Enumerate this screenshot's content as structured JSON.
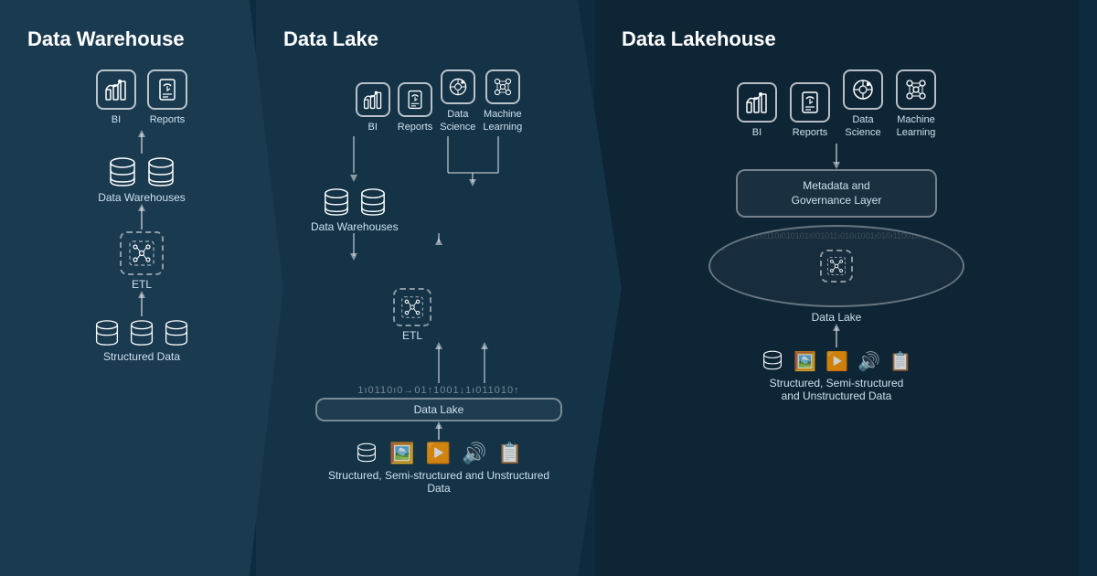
{
  "warehouse": {
    "title": "Data Warehouse",
    "icons": [
      {
        "label": "BI",
        "icon": "📊"
      },
      {
        "label": "Reports",
        "icon": "📄"
      }
    ],
    "dataWarehouses": "Data Warehouses",
    "etl": "ETL",
    "structuredData": "Structured Data"
  },
  "lake": {
    "title": "Data Lake",
    "icons": [
      {
        "label": "BI",
        "icon": "📊"
      },
      {
        "label": "Reports",
        "icon": "📄"
      },
      {
        "label": "Data\nScience",
        "icon": "🔍"
      },
      {
        "label": "Machine\nLearning",
        "icon": "🤖"
      }
    ],
    "dataWarehouses": "Data Warehouses",
    "etl": "ETL",
    "dataLake": "Data Lake",
    "structuredData": "Structured, Semi-structured and Unstructured Data"
  },
  "lakehouse": {
    "title": "Data Lakehouse",
    "icons": [
      {
        "label": "BI",
        "icon": "📊"
      },
      {
        "label": "Reports",
        "icon": "📄"
      },
      {
        "label": "Data\nScience",
        "icon": "🔍"
      },
      {
        "label": "Machine\nLearning",
        "icon": "🤖"
      }
    ],
    "metadataLayer": "Metadata and\nGovernance Layer",
    "dataLake": "Data Lake",
    "structuredData": "Structured, Semi-structured\nand Unstructured Data"
  },
  "binary": "1ı0110ı0101100101ı0110101",
  "binaryLong": "1ı0110ı0101100101ı0110101ı01011001011ı011"
}
